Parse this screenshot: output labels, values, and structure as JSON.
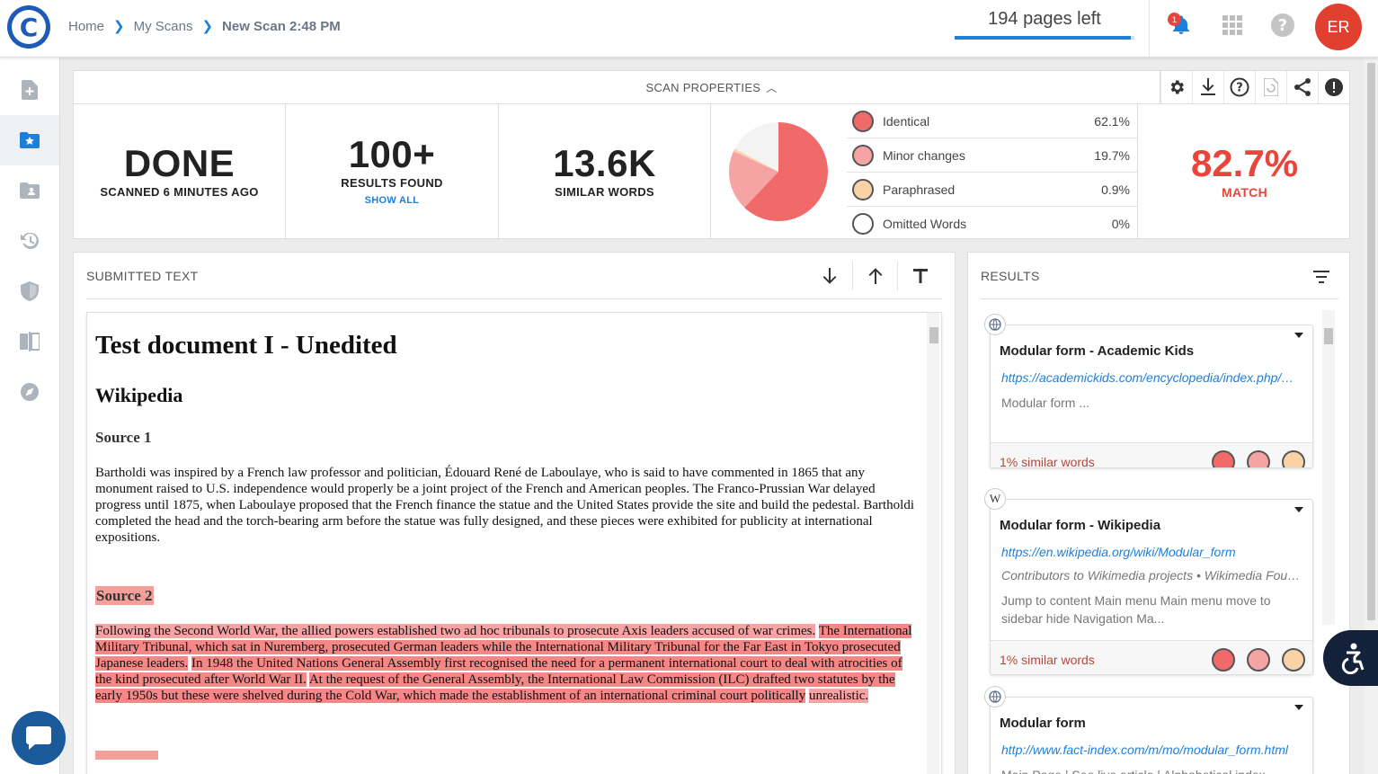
{
  "header": {
    "breadcrumbs": [
      "Home",
      "My Scans",
      "New Scan 2:48 PM"
    ],
    "pages_left": "194 pages left",
    "pages_progress_fraction": 0.98,
    "notification_count": "1",
    "avatar_initials": "ER"
  },
  "props": {
    "title": "SCAN PROPERTIES",
    "status": "DONE",
    "status_sub": "SCANNED 6 MINUTES AGO",
    "results": "100+",
    "results_sub": "RESULTS FOUND",
    "show_all": "SHOW ALL",
    "words": "13.6K",
    "words_sub": "SIMILAR WORDS",
    "legend": [
      {
        "label": "Identical",
        "value": "62.1%",
        "color": "#f06a6a"
      },
      {
        "label": "Minor changes",
        "value": "19.7%",
        "color": "#f5a3a3"
      },
      {
        "label": "Paraphrased",
        "value": "0.9%",
        "color": "#fad2a8"
      },
      {
        "label": "Omitted Words",
        "value": "0%",
        "color": "#ffffff"
      }
    ],
    "match": "82.7%",
    "match_sub": "MATCH"
  },
  "submitted": {
    "title": "SUBMITTED TEXT",
    "doc_title": "Test document I - Unedited",
    "doc_h2": "Wikipedia",
    "source1": "Source 1",
    "p1": "Bartholdi was inspired by a French law professor and politician, Édouard René de Laboulaye, who is said to have commented in 1865 that any monument raised to U.S. independence would properly be a joint project of the French and American peoples. The Franco-Prussian War delayed progress until 1875, when Laboulaye proposed that the French finance the statue and the United States provide the site and build the pedestal. Bartholdi completed the head and the torch-bearing arm before the statue was fully designed, and these pieces were exhibited for publicity at international expositions.",
    "source2": "Source 2",
    "p2_a": "Following the Second World War, the allied powers established two ad hoc tribunals to prosecute Axis leaders accused of war crimes.",
    "p2_b": "The International Military Tribunal, which sat in Nuremberg, prosecuted German leaders while the International Military Tribunal for the Far East in Tokyo prosecuted Japanese leaders.",
    "p2_c": "In 1948 the United Nations General Assembly first recognised the need for a permanent international court to deal with atrocities of the kind prosecuted after World War II.",
    "p2_d": "At the request of the General Assembly, the International Law Commission (ILC) drafted two statutes by the early 1950s but these were shelved during the Cold War, which made the establishment of an international criminal court politically",
    "p2_e": "unrealistic."
  },
  "results": {
    "title": "RESULTS",
    "cards": [
      {
        "badge": "globe-icon",
        "title": "Modular form - Academic Kids",
        "url": "https://academickids.com/encyclopedia/index.php/Modular_form",
        "meta": "",
        "desc": "Modular form ...",
        "similar": "1% similar words"
      },
      {
        "badge": "W",
        "title": "Modular form - Wikipedia",
        "url": "https://en.wikipedia.org/wiki/Modular_form",
        "meta": "Contributors to Wikimedia projects  •  Wikimedia Foundation",
        "desc": "Jump to content Main menu Main menu move to sidebar hide Navigation Ma...",
        "similar": "1% similar words"
      },
      {
        "badge": "globe-icon",
        "title": "Modular form",
        "url": "http://www.fact-index.com/m/mo/modular_form.html",
        "meta": "",
        "desc": "Main Page | See live article | Alphabetical index",
        "similar": ""
      }
    ]
  },
  "colors": {
    "accent": "#1e7fd8",
    "match_red": "#e8453c",
    "identical": "#f06a6a",
    "minor": "#f5a3a3",
    "paraphrased": "#fad2a8"
  }
}
